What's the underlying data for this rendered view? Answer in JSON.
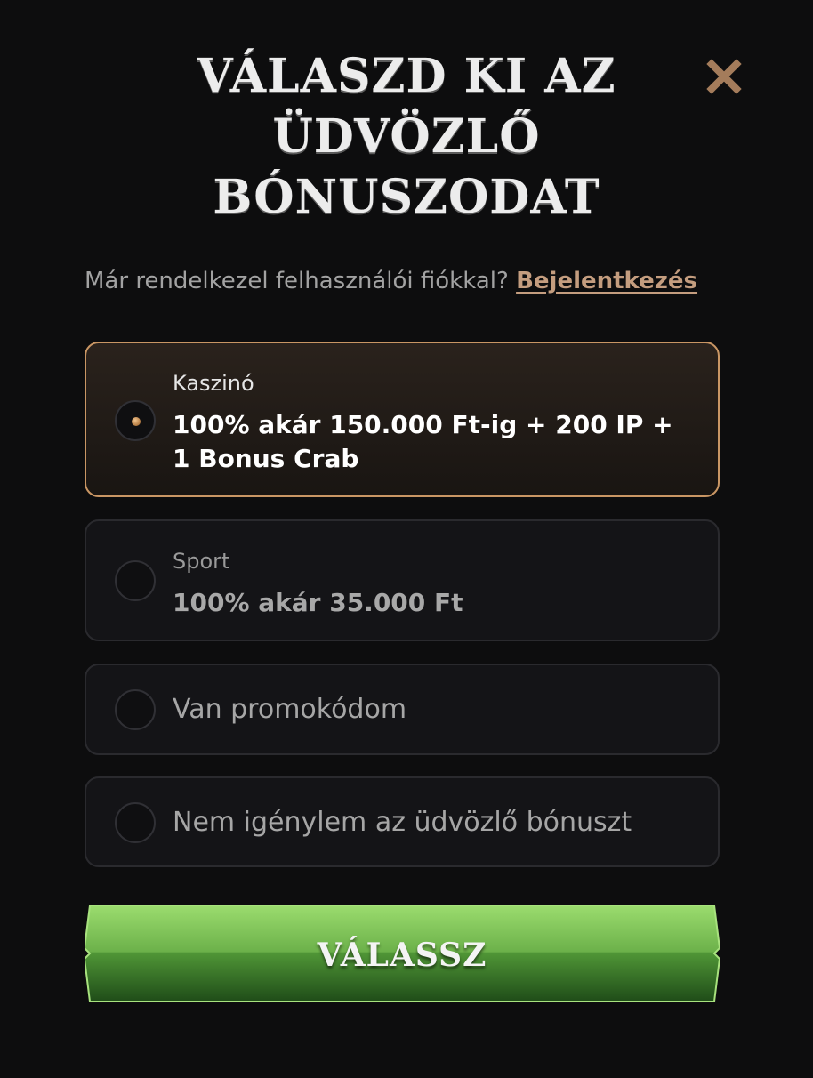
{
  "modal": {
    "title": "VÁLASZD KI AZ ÜDVÖZLŐ BÓNUSZODAT",
    "close_icon": "close-icon"
  },
  "login": {
    "prompt": "Már rendelkezel felhasználói fiókkal?",
    "link_label": "Bejelentkezés"
  },
  "options": [
    {
      "category": "Kaszinó",
      "title": "100% akár 150.000 Ft-ig + 200 IP + 1 Bonus Crab",
      "selected": true
    },
    {
      "category": "Sport",
      "title": "100% akár 35.000 Ft",
      "selected": false
    },
    {
      "label": "Van promokódom",
      "selected": false
    },
    {
      "label": "Nem igénylem az üdvözlő bónuszt",
      "selected": false
    }
  ],
  "submit": {
    "label": "VÁLASSZ"
  },
  "colors": {
    "background": "#0d0d0e",
    "accent": "#c99664",
    "link": "#c49d7f",
    "button_top": "#8fd466",
    "button_bottom": "#24551a"
  }
}
